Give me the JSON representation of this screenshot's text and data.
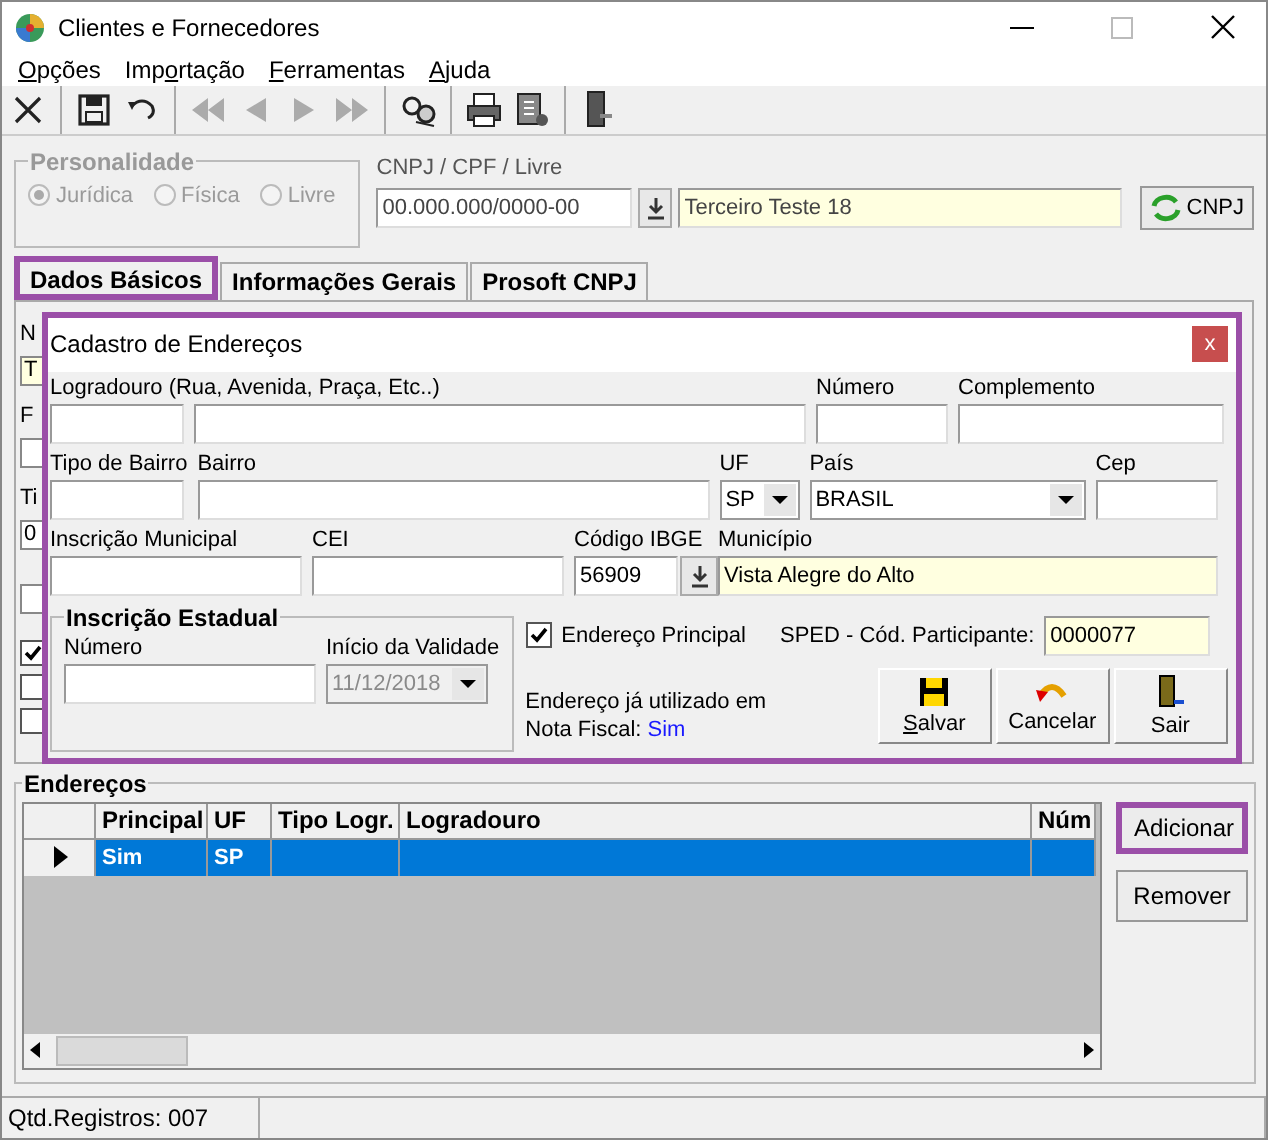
{
  "window": {
    "title": "Clientes e Fornecedores"
  },
  "menu": [
    {
      "key": "O",
      "after": "pções"
    },
    {
      "before": "Imp",
      "key": "o",
      "after": "rtação"
    },
    {
      "key": "F",
      "after": "erramentas"
    },
    {
      "key": "A",
      "after": "juda"
    }
  ],
  "toolbar": [
    {
      "kind": "close",
      "disabled": false
    },
    {
      "kind": "separator",
      "disabled": false
    },
    {
      "kind": "save",
      "disabled": false
    },
    {
      "kind": "undo",
      "disabled": false
    },
    {
      "kind": "separator",
      "disabled": false
    },
    {
      "kind": "first",
      "disabled": true
    },
    {
      "kind": "prev",
      "disabled": true
    },
    {
      "kind": "next",
      "disabled": true
    },
    {
      "kind": "last",
      "disabled": true
    },
    {
      "kind": "separator",
      "disabled": false
    },
    {
      "kind": "find",
      "disabled": false
    },
    {
      "kind": "separator",
      "disabled": false
    },
    {
      "kind": "print",
      "disabled": false
    },
    {
      "kind": "report",
      "disabled": false
    },
    {
      "kind": "separator",
      "disabled": false
    },
    {
      "kind": "exit",
      "disabled": false
    }
  ],
  "personalidade": {
    "title": "Personalidade",
    "disabled": true,
    "options": [
      {
        "label": "Jurídica",
        "selected": true
      },
      {
        "label": "Física",
        "selected": false
      },
      {
        "label": "Livre",
        "selected": false
      }
    ]
  },
  "document": {
    "label": "CNPJ / CPF / Livre",
    "value": "00.000.000/0000-00",
    "name": "Terceiro Teste 18",
    "button": "CNPJ"
  },
  "tabs": [
    {
      "label": "Dados Básicos",
      "selected": true,
      "highlighted": true
    },
    {
      "label": "Informações Gerais",
      "selected": false,
      "highlighted": false
    },
    {
      "label": "Prosoft CNPJ",
      "selected": false,
      "highlighted": false
    }
  ],
  "behind": [
    {
      "kind": "label",
      "text": "N"
    },
    {
      "kind": "field",
      "value": "T",
      "required": true
    },
    {
      "kind": "label",
      "text": "F"
    },
    {
      "kind": "field",
      "required": false
    },
    {
      "kind": "label",
      "text": "Ti"
    },
    {
      "kind": "field",
      "value": "0",
      "required": false
    },
    {
      "kind": "field",
      "required": false
    },
    {
      "kind": "checkbox",
      "checked": true
    },
    {
      "kind": "checkbox",
      "checked": false
    },
    {
      "kind": "checkbox",
      "checked": false
    }
  ],
  "dialog": {
    "title": "Cadastro de Endereços",
    "close": "x",
    "highlighted": true,
    "logradouro_label": "Logradouro (Rua, Avenida, Praça, Etc..)",
    "numero_label": "Número",
    "complemento_label": "Complemento",
    "tipo_bairro_label": "Tipo de Bairro",
    "bairro_label": "Bairro",
    "uf_label": "UF",
    "uf": "SP",
    "pais_label": "País",
    "pais": "BRASIL",
    "cep_label": "Cep",
    "insc_municipal_label": "Inscrição Municipal",
    "cei_label": "CEI",
    "ibge_label": "Código IBGE",
    "ibge": "56909",
    "municipio_label": "Município",
    "municipio": "Vista Alegre do Alto",
    "inscricao_estadual": {
      "title": "Inscrição Estadual",
      "numero_label": "Número",
      "validade_label": "Início da Validade",
      "validade": "11/12/2018",
      "validade_disabled": true
    },
    "principal": {
      "label": "Endereço Principal",
      "checked": true
    },
    "sped_label": "SPED - Cód. Participante:",
    "sped": "0000077",
    "used_label": "Endereço já utilizado em Nota Fiscal:",
    "used_value": "Sim",
    "buttons": [
      {
        "kind": "save",
        "key": "S",
        "after": "alvar"
      },
      {
        "kind": "cancel",
        "before": "Cancelar"
      },
      {
        "kind": "exit",
        "before": "Sair"
      }
    ]
  },
  "enderecos": {
    "title": "Endereços",
    "columns": [
      "Principal",
      "UF",
      "Tipo Logr.",
      "Logradouro",
      "Núm"
    ],
    "rows": [
      {
        "selected": true,
        "cells": [
          "Sim",
          "SP",
          "",
          "",
          ""
        ]
      }
    ],
    "buttons": [
      {
        "label": "Adicionar",
        "highlighted": true
      },
      {
        "label": "Remover",
        "highlighted": false
      }
    ]
  },
  "status_bar": {
    "records": "Qtd.Registros: 007"
  }
}
